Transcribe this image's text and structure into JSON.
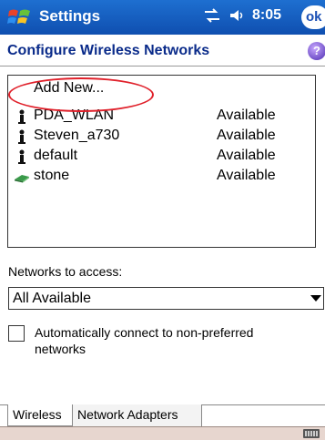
{
  "titlebar": {
    "app_title": "Settings",
    "time": "8:05",
    "ok_label": "ok"
  },
  "header": {
    "page_title": "Configure Wireless Networks",
    "help_label": "?"
  },
  "network_list": {
    "add_new_label": "Add New...",
    "items": [
      {
        "name": "PDA_WLAN",
        "status": "Available",
        "icon": "infrastructure-antenna-icon"
      },
      {
        "name": "Steven_a730",
        "status": "Available",
        "icon": "infrastructure-antenna-icon"
      },
      {
        "name": "default",
        "status": "Available",
        "icon": "infrastructure-antenna-icon"
      },
      {
        "name": "stone",
        "status": "Available",
        "icon": "ad-hoc-pc-icon"
      }
    ]
  },
  "access": {
    "label": "Networks to access:",
    "selected": "All Available"
  },
  "auto_connect": {
    "label": "Automatically connect to non-preferred networks",
    "checked": false
  },
  "tabs": [
    {
      "label": "Wireless",
      "active": true
    },
    {
      "label": "Network Adapters",
      "active": false
    }
  ],
  "colors": {
    "titlebar": "#1e6fd0",
    "highlight": "#e0202a",
    "menubar": "#e7d6cf"
  }
}
